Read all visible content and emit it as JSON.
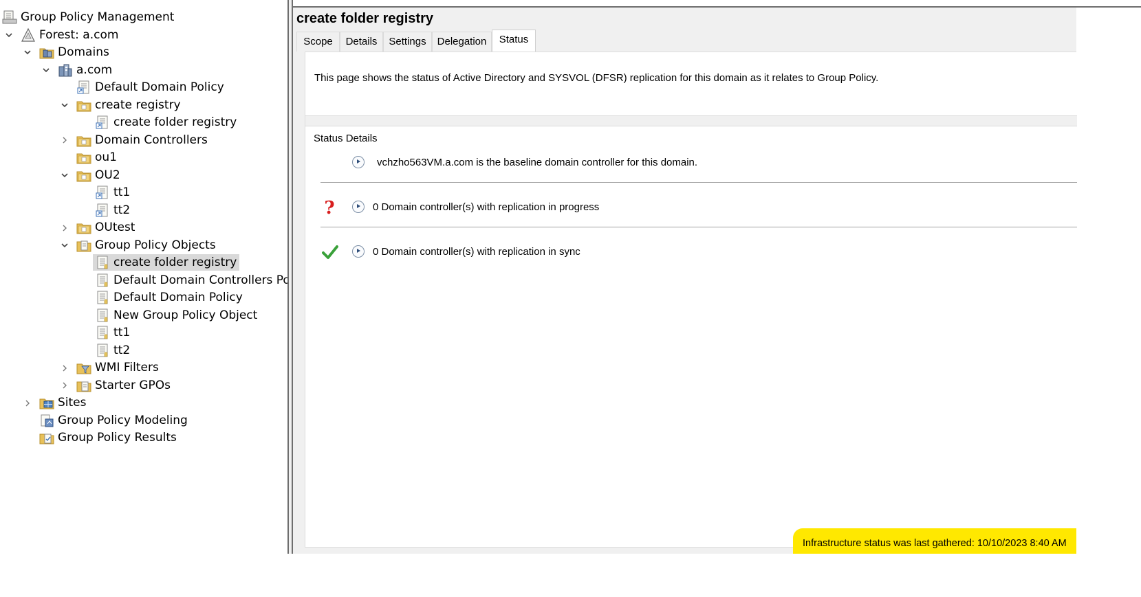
{
  "tree": {
    "root": "Group Policy Management",
    "forest": "Forest: a.com",
    "domains": "Domains",
    "domain": "a.com",
    "default_domain_policy": "Default Domain Policy",
    "create_registry": "create registry",
    "create_folder_registry_link": "create folder registry",
    "domain_controllers": "Domain Controllers",
    "ou1": "ou1",
    "ou2": "OU2",
    "tt1_link": "tt1",
    "tt2_link": "tt2",
    "outest": "OUtest",
    "gpo_container": "Group Policy Objects",
    "gpos": [
      "create folder registry",
      "Default Domain Controllers Policy",
      "Default Domain Policy",
      "New Group Policy Object",
      "tt1",
      "tt2"
    ],
    "wmi_filters": "WMI Filters",
    "starter_gpos": "Starter GPOs",
    "sites": "Sites",
    "modeling": "Group Policy Modeling",
    "results": "Group Policy Results"
  },
  "details": {
    "title": "create folder registry",
    "tabs": [
      "Scope",
      "Details",
      "Settings",
      "Delegation",
      "Status"
    ],
    "active_tab": "Status",
    "description": "This page shows the status of Active Directory and SYSVOL (DFSR) replication for this domain as it relates to Group Policy.",
    "status_header": "Status Details",
    "baseline": "vchzho563VM.a.com is the baseline domain controller for this domain.",
    "in_progress": "0 Domain controller(s) with replication in progress",
    "in_sync": "0 Domain controller(s) with replication in sync",
    "footer": "Infrastructure status was last gathered: 10/10/2023 8:40 AM"
  },
  "colors": {
    "highlight": "#ffe800",
    "question": "#d81e1e",
    "check": "#3aa13a",
    "selection": "#d9d9d9"
  }
}
